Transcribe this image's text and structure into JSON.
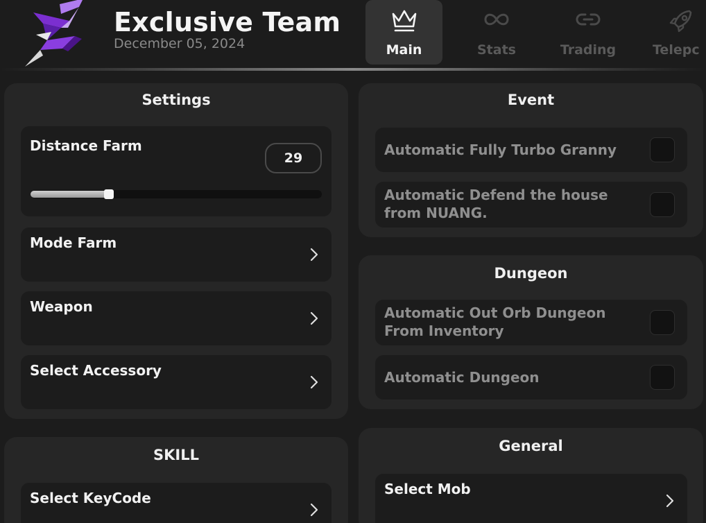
{
  "header": {
    "title": "Exclusive Team",
    "date": "December 05, 2024"
  },
  "tabs": [
    {
      "label": "Main",
      "icon": "crown-icon",
      "active": true
    },
    {
      "label": "Stats",
      "icon": "infinity-icon",
      "active": false
    },
    {
      "label": "Trading",
      "icon": "link-icon",
      "active": false
    },
    {
      "label": "Telepc",
      "icon": "rocket-icon",
      "active": false
    }
  ],
  "settings": {
    "title": "Settings",
    "distance_farm": {
      "label": "Distance Farm",
      "value": "29",
      "slider_fraction": 0.27
    },
    "mode_farm": {
      "label": "Mode Farm"
    },
    "weapon": {
      "label": "Weapon"
    },
    "select_accessory": {
      "label": "Select Accessory"
    }
  },
  "event": {
    "title": "Event",
    "toggles": [
      {
        "label": "Automatic Fully Turbo Granny",
        "checked": false
      },
      {
        "label_lines": [
          "Automatic Defend the house",
          "from NUANG."
        ],
        "checked": false
      }
    ]
  },
  "dungeon": {
    "title": "Dungeon",
    "toggles": [
      {
        "label_lines": [
          "Automatic Out Orb Dungeon",
          "From Inventory"
        ],
        "checked": false
      },
      {
        "label": "Automatic Dungeon",
        "checked": false
      }
    ]
  },
  "skill": {
    "title": "SKILL",
    "select_keycode": {
      "label": "Select KeyCode"
    }
  },
  "general": {
    "title": "General",
    "select_mob": {
      "label": "Select Mob"
    }
  },
  "colors": {
    "background": "#1c1c1c",
    "panel": "#262626",
    "card": "#1c1c1c",
    "logo_purple": "#7b2fd0"
  }
}
